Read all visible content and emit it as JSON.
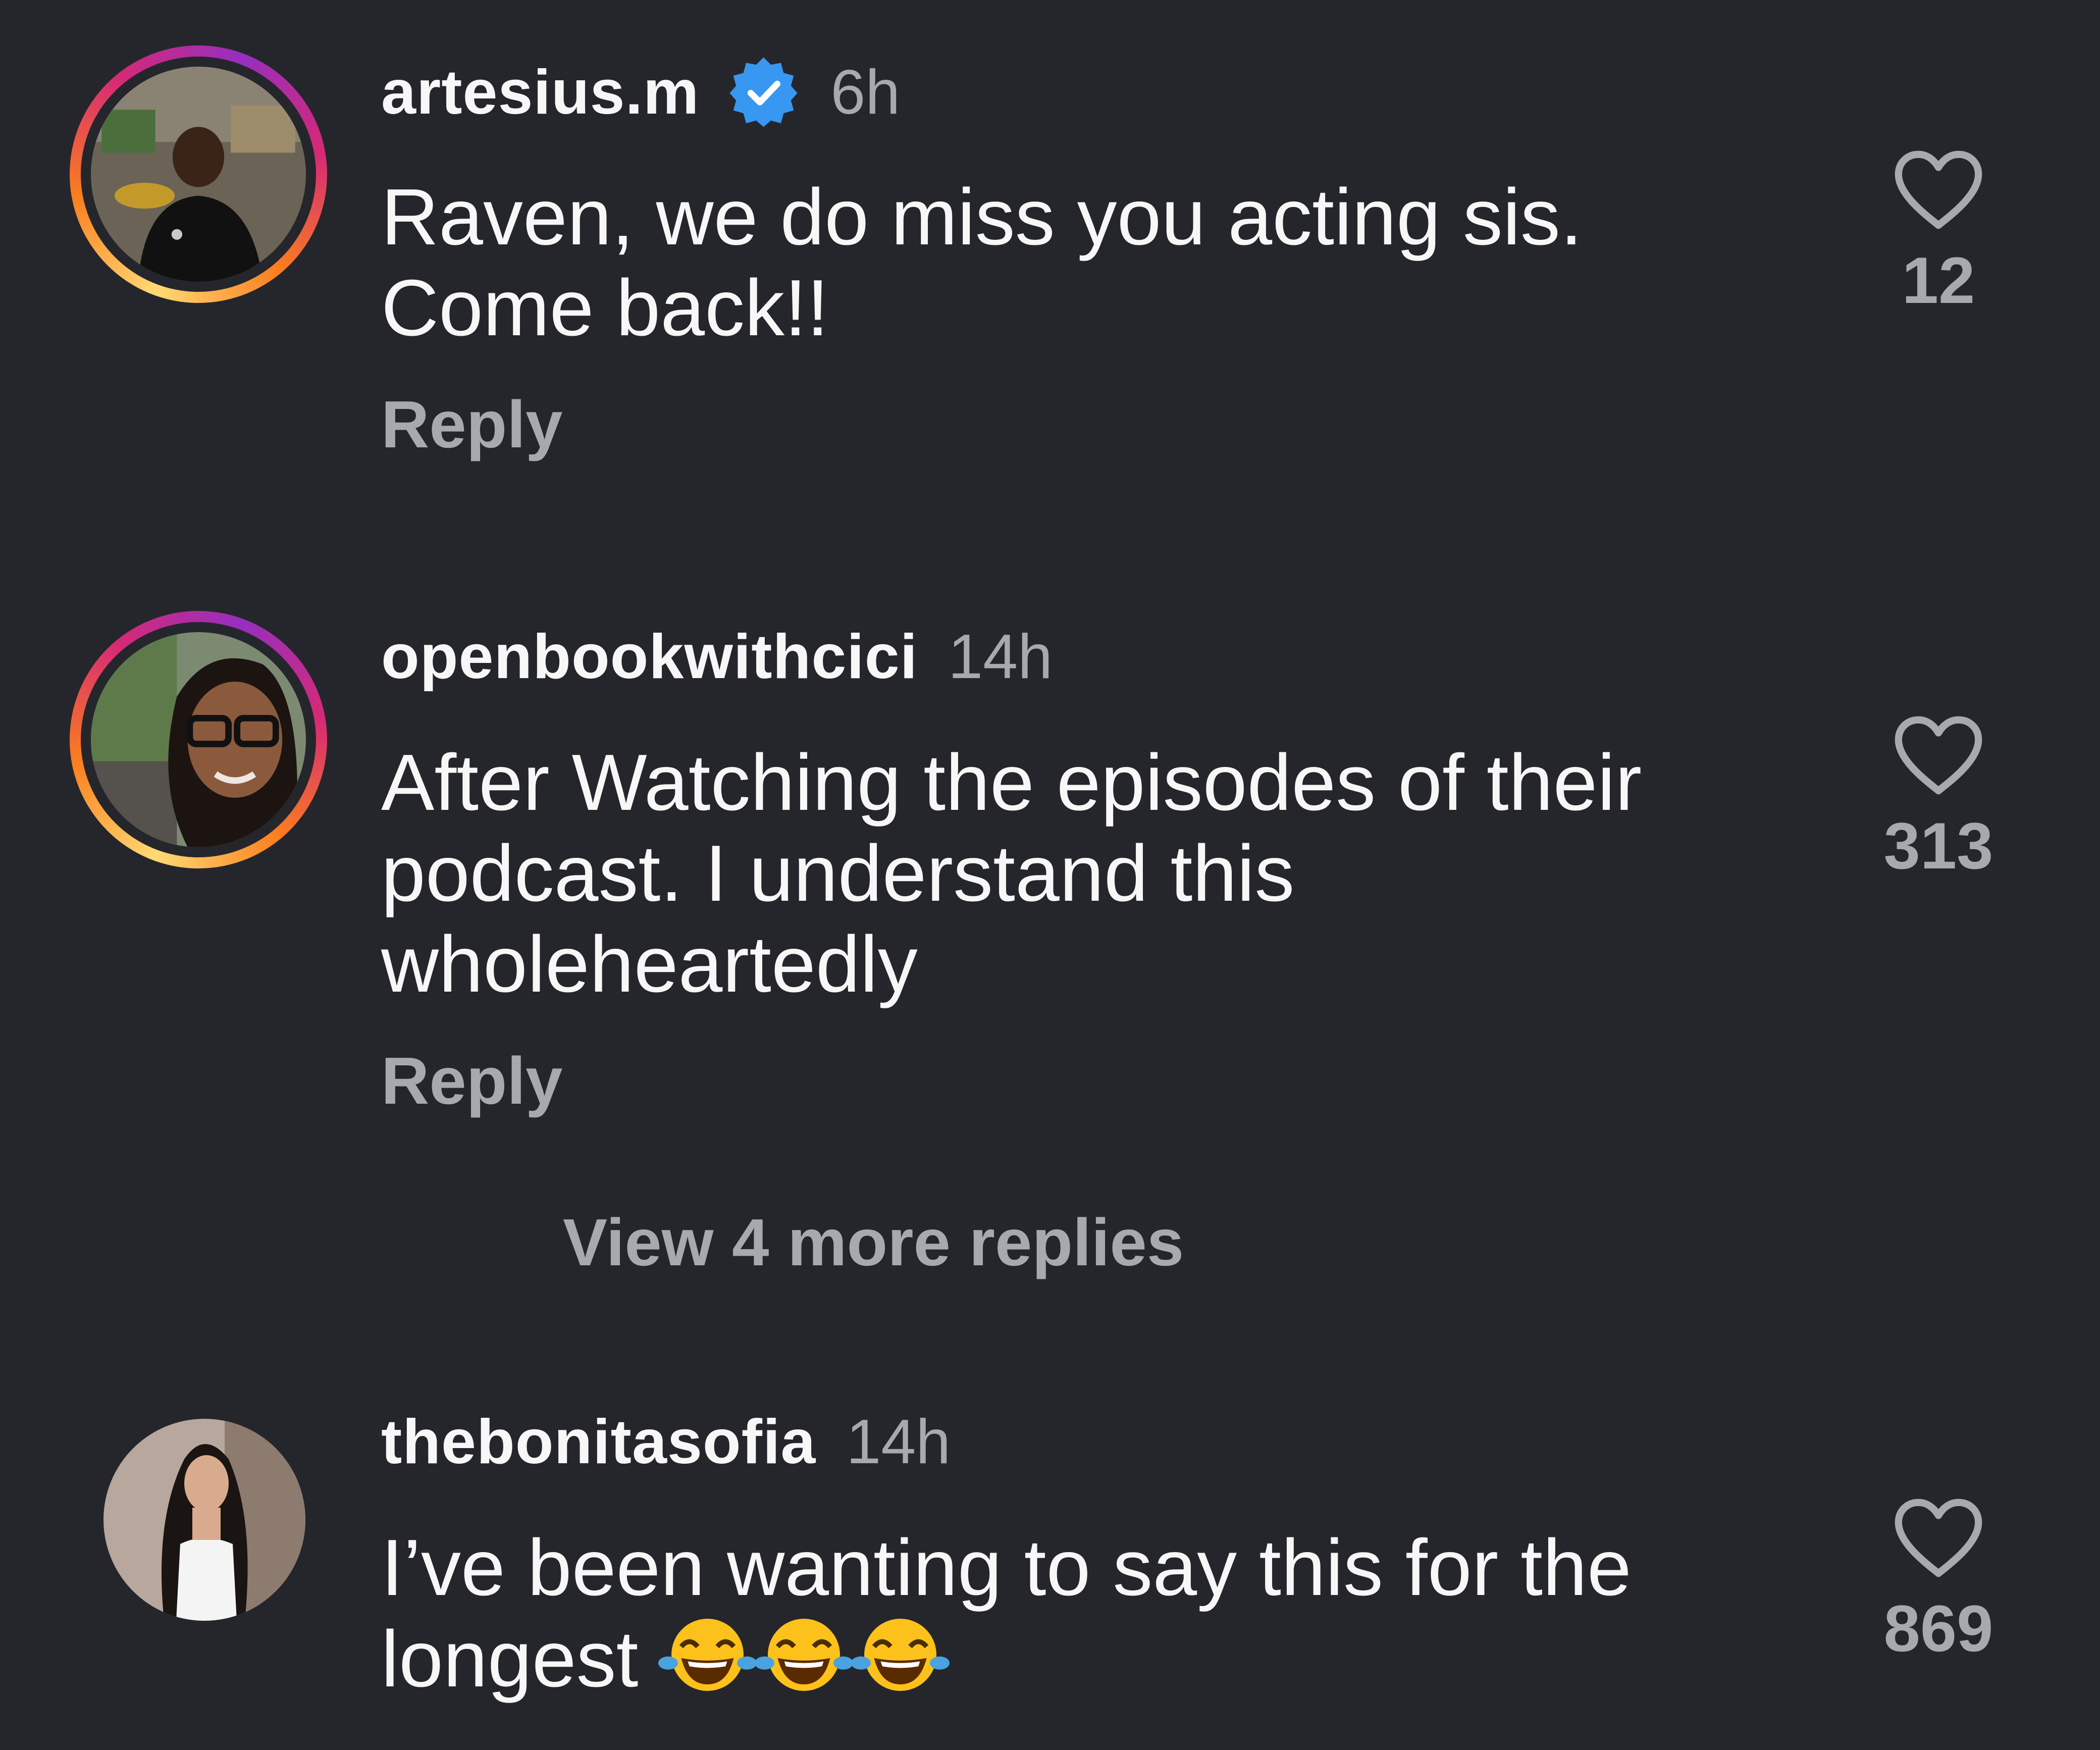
{
  "comments": [
    {
      "username": "artesius.m",
      "verified": true,
      "time": "6h",
      "lines": [
        "Raven, we do miss you acting sis.",
        "Come back!!"
      ],
      "reply_label": "Reply",
      "likes": "12",
      "story_ring": true
    },
    {
      "username": "openbookwithcici",
      "verified": false,
      "time": "14h",
      "lines": [
        "After Watching the episodes of their",
        "podcast. I understand this",
        "wholeheartedly"
      ],
      "reply_label": "Reply",
      "likes": "313",
      "story_ring": true
    },
    {
      "username": "thebonitasofia",
      "verified": false,
      "time": "14h",
      "lines": [
        "I’ve been wanting to say this for the",
        "longest"
      ],
      "emojis": [
        "face-with-tears-of-joy",
        "face-with-tears-of-joy",
        "face-with-tears-of-joy"
      ],
      "likes": "869",
      "story_ring": false
    }
  ],
  "view_more_replies": "View 4 more replies",
  "icons": {
    "verified_badge": "verified-badge-icon",
    "like": "heart-outline-icon"
  },
  "colors": {
    "background": "#25262c",
    "primary_text": "#f7f7f7",
    "secondary_text": "#a8a9ae",
    "verified_blue": "#3897f0"
  }
}
